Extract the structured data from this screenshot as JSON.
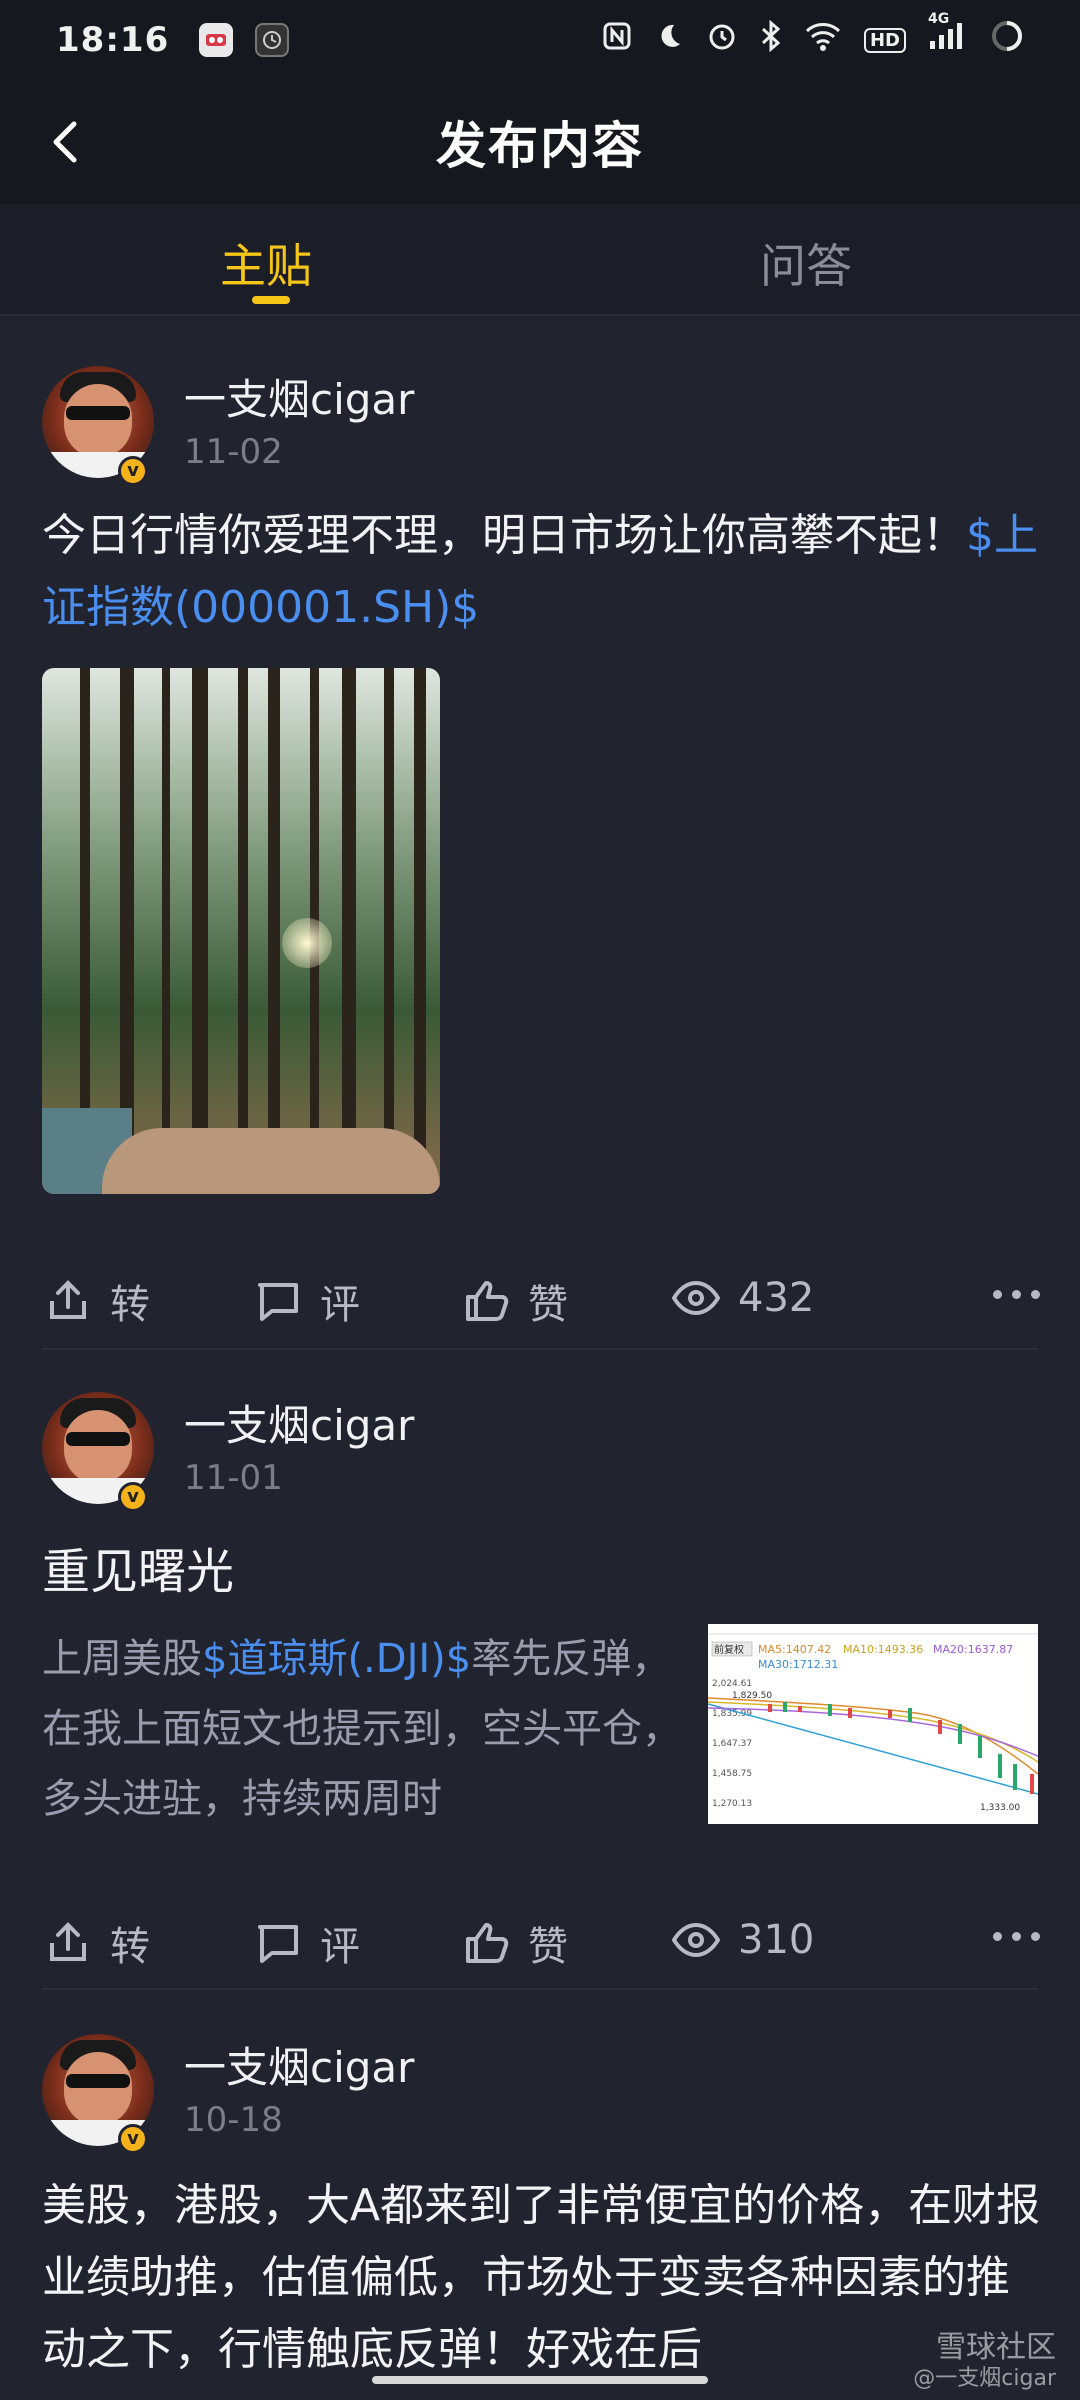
{
  "status_bar": {
    "time": "18:16",
    "network": "4G",
    "hd": "HD"
  },
  "header": {
    "title": "发布内容"
  },
  "tabs": [
    {
      "label": "主贴",
      "active": true
    },
    {
      "label": "问答",
      "active": false
    }
  ],
  "posts": [
    {
      "username": "一支烟cigar",
      "date": "11-02",
      "text_prefix": "今日行情你爱理不理，明日市场让你高攀不起！",
      "link": "$上证指数(000001.SH)$",
      "actions": {
        "repost": "转",
        "comment": "评",
        "like": "赞",
        "views": "432"
      }
    },
    {
      "username": "一支烟cigar",
      "date": "11-01",
      "title": "重见曙光",
      "excerpt_prefix": "上周美股",
      "link": "$道琼斯(.DJI)$",
      "excerpt_suffix": "率先反弹，在我上面短文也提示到，空头平仓，多头进驻，持续两周时",
      "chart_thumb": {
        "tag": "前复权",
        "ma5": "MA5:1407.42",
        "ma10": "MA10:1493.36",
        "ma20": "MA20:1637.87",
        "ma30": "MA30:1712.31",
        "price_labels": [
          "2,024.61",
          "1,835.99",
          "1,647.37",
          "1,458.75",
          "1,270.13"
        ],
        "marker_high": "1,829.50",
        "marker_low": "1,333.00"
      },
      "actions": {
        "repost": "转",
        "comment": "评",
        "like": "赞",
        "views": "310"
      }
    },
    {
      "username": "一支烟cigar",
      "date": "10-18",
      "text": "美股，港股，大A都来到了非常便宜的价格，在财报业绩助推，估值偏低，市场处于变卖各种因素的推动之下，行情触底反弹！好戏在后"
    }
  ],
  "watermark": {
    "brand": "雪球社区",
    "author": "@一支烟cigar"
  },
  "colors": {
    "accent": "#f5c518",
    "link": "#4a8ef0",
    "background": "#21232e"
  }
}
